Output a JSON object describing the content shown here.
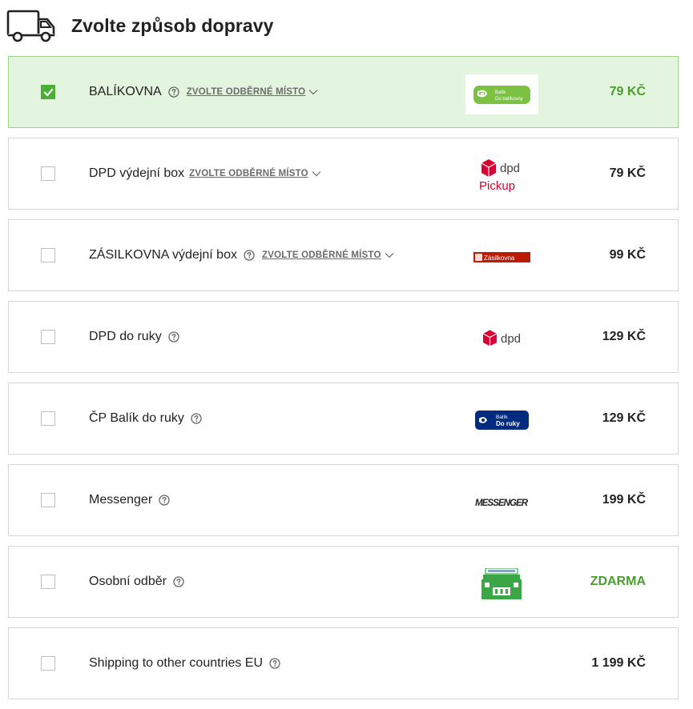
{
  "page": {
    "title": "Zvolte způsob dopravy",
    "header_icon": "truck-icon"
  },
  "accent_colors": {
    "selected_background": "#e4f5df",
    "selected_border": "#9ad28a",
    "check_green": "#4caf35",
    "price_green": "#4a9c2f"
  },
  "shipping_options": [
    {
      "id": "balikovna",
      "name": "BALÍKOVNA",
      "selected": true,
      "help_icon": true,
      "pickup_link": "ZVOLTE ODBĚRNÉ MÍSTO",
      "price": "79 KČ",
      "logo": {
        "name": "balikovna-logo",
        "line1": "Balík",
        "line2": "Do balíkovny",
        "color": "#7cc242"
      }
    },
    {
      "id": "dpd-box",
      "name": "DPD výdejní box",
      "selected": false,
      "help_icon": false,
      "pickup_link": "ZVOLTE ODBĚRNÉ MÍSTO",
      "price": "79 KČ",
      "logo": {
        "name": "dpd-pickup-logo",
        "line1": "dpd",
        "line2": "Pickup",
        "color": "#dc0032"
      }
    },
    {
      "id": "zasilkovna-box",
      "name": "ZÁSILKOVNA výdejní box",
      "selected": false,
      "help_icon": true,
      "pickup_link": "ZVOLTE ODBĚRNÉ MÍSTO",
      "price": "99 KČ",
      "logo": {
        "name": "zasilkovna-logo",
        "line1": "Zásilkovna",
        "color": "#ba1b02"
      }
    },
    {
      "id": "dpd-ruky",
      "name": "DPD do ruky",
      "selected": false,
      "help_icon": true,
      "pickup_link": "",
      "price": "129 KČ",
      "logo": {
        "name": "dpd-logo",
        "line1": "dpd",
        "color": "#dc0032"
      }
    },
    {
      "id": "cp-balik",
      "name": "ČP Balík do ruky",
      "selected": false,
      "help_icon": true,
      "pickup_link": "",
      "price": "129 KČ",
      "logo": {
        "name": "cp-balik-do-ruky-logo",
        "line1": "Balík",
        "line2": "Do ruky",
        "color": "#002b7f"
      }
    },
    {
      "id": "messenger",
      "name": "Messenger",
      "selected": false,
      "help_icon": true,
      "pickup_link": "",
      "price": "199 KČ",
      "logo": {
        "name": "messenger-logo",
        "line1": "MESSENGER",
        "color": "#222222"
      }
    },
    {
      "id": "osobni-odber",
      "name": "Osobní odběr",
      "selected": false,
      "help_icon": true,
      "pickup_link": "",
      "price": "ZDARMA",
      "price_free": true,
      "logo": {
        "name": "store-building-icon",
        "color": "#3aa645"
      }
    },
    {
      "id": "eu",
      "name": "Shipping to other countries EU",
      "selected": false,
      "help_icon": true,
      "pickup_link": "",
      "price": "1 199 KČ"
    }
  ]
}
